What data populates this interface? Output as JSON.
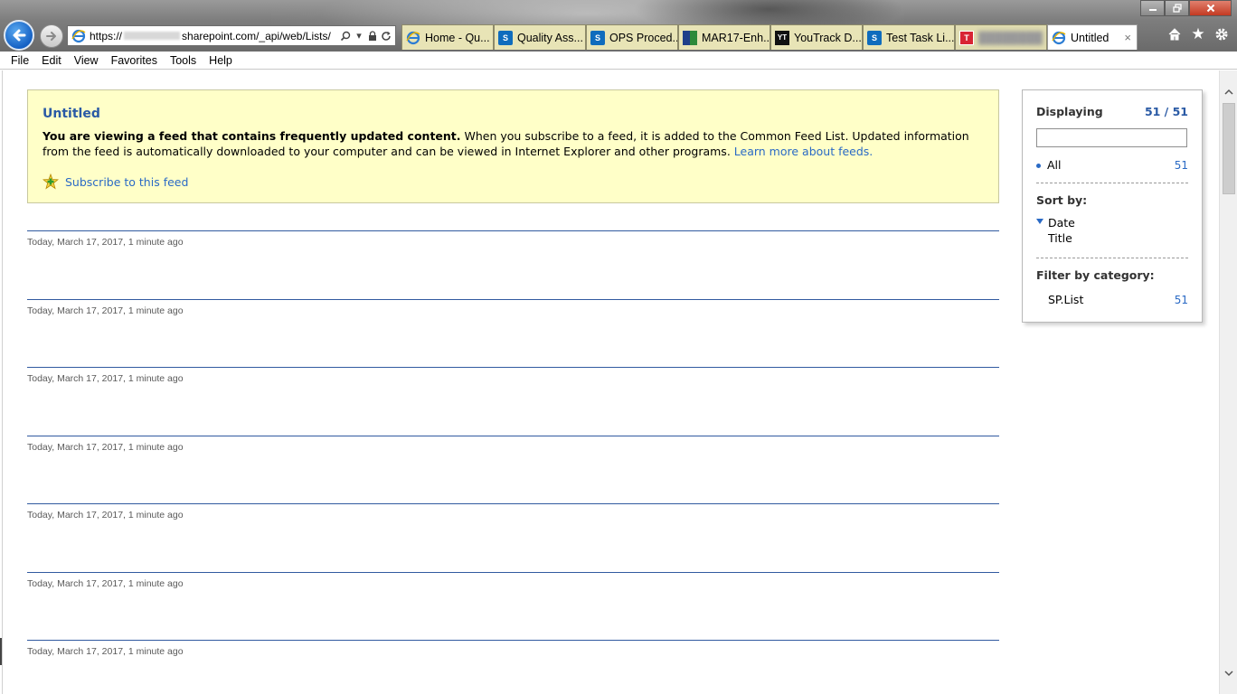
{
  "browser": {
    "address": {
      "prefix": "https://",
      "suffix": "sharepoint.com/_api/web/Lists/"
    },
    "tabs": [
      {
        "label": "Home - Qu...",
        "icon": "ie-icon",
        "blurred": false
      },
      {
        "label": "Quality Ass...",
        "icon": "sharepoint-icon",
        "blurred": false
      },
      {
        "label": "OPS Proced...",
        "icon": "sharepoint-icon",
        "blurred": false
      },
      {
        "label": "MAR17-Enh...",
        "icon": "grid-app-icon",
        "blurred": false
      },
      {
        "label": "YouTrack D...",
        "icon": "youtrack-icon",
        "blurred": false
      },
      {
        "label": "Test Task Li...",
        "icon": "sharepoint-icon",
        "blurred": false
      },
      {
        "label": "",
        "icon": "t-app-icon",
        "blurred": true
      },
      {
        "label": "Untitled",
        "icon": "ie-icon",
        "active": true,
        "close": "×"
      }
    ]
  },
  "menu": [
    "File",
    "Edit",
    "View",
    "Favorites",
    "Tools",
    "Help"
  ],
  "feed": {
    "title": "Untitled",
    "notice_bold": "You are viewing a feed that contains frequently updated content.",
    "notice_text": " When you subscribe to a feed, it is added to the Common Feed List. Updated information from the feed is automatically downloaded to your computer and can be viewed in Internet Explorer and other programs. ",
    "learn_more": "Learn more about feeds.",
    "subscribe_label": "Subscribe to this feed",
    "items": [
      {
        "date": "Today, March 17, 2017, 1 minute ago"
      },
      {
        "date": "Today, March 17, 2017, 1 minute ago"
      },
      {
        "date": "Today, March 17, 2017, 1 minute ago"
      },
      {
        "date": "Today, March 17, 2017, 1 minute ago"
      },
      {
        "date": "Today, March 17, 2017, 1 minute ago"
      },
      {
        "date": "Today, March 17, 2017, 1 minute ago"
      },
      {
        "date": "Today, March 17, 2017, 1 minute ago"
      }
    ]
  },
  "panel": {
    "displaying_label": "Displaying",
    "displaying_count": "51 / 51",
    "search_value": "",
    "all_label": "All",
    "all_count": "51",
    "sort_label": "Sort by:",
    "sort_options": [
      "Date",
      "Title"
    ],
    "filter_label": "Filter by category:",
    "categories": [
      {
        "name": "SP.List",
        "count": "51"
      }
    ]
  },
  "colors": {
    "accent_blue": "#2a6ac5",
    "feed_title": "#2a5aa5",
    "notice_bg": "#ffffc8",
    "rule": "#315aa0"
  }
}
